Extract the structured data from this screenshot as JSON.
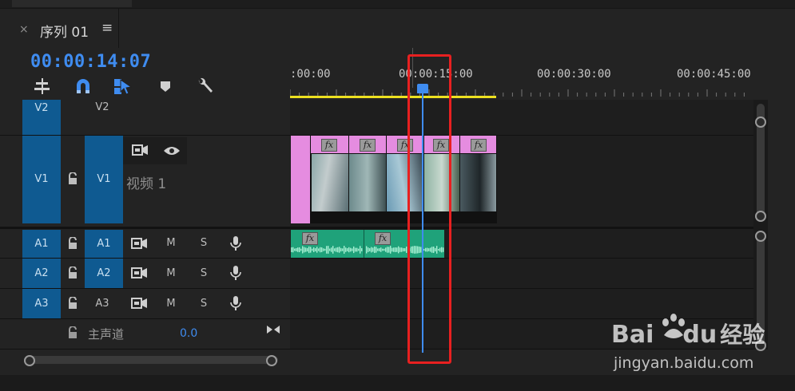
{
  "panel": {
    "close_glyph": "×",
    "title": "序列 01",
    "menu_glyph": "≡",
    "timecode": "00:00:14:07"
  },
  "ruler": {
    "labels": [
      ":00:00",
      "00:00:15:00",
      "00:00:30:00",
      "00:00:45:00"
    ]
  },
  "tracks": {
    "v2": {
      "target": "V2",
      "label": "V2"
    },
    "v1": {
      "target": "V1",
      "label": "V1",
      "name": "视频 1"
    },
    "a1": {
      "target": "A1",
      "label": "A1",
      "m": "M",
      "s": "S"
    },
    "a2": {
      "target": "A2",
      "label": "A2",
      "m": "M",
      "s": "S"
    },
    "a3": {
      "target": "A3",
      "label": "A3",
      "m": "M",
      "s": "S"
    },
    "master": {
      "label": "主声道",
      "value": "0.0"
    }
  },
  "clips": {
    "fx_label": "fx"
  },
  "watermark": {
    "brand_a": "Bai",
    "brand_b": "du",
    "brand_c": "经验",
    "url": "jingyan.baidu.com"
  },
  "colors": {
    "accent": "#3f8cf0",
    "track_target": "#0f5a91",
    "work_area": "#ece020",
    "video_clip_header": "#e58ce0",
    "audio_clip": "#1fa27a",
    "highlight_box": "#e82020"
  }
}
